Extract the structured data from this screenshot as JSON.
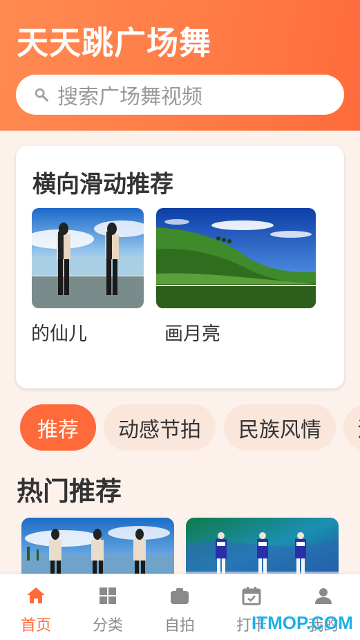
{
  "header": {
    "title": "天天跳广场舞",
    "search_placeholder": "搜索广场舞视频"
  },
  "recommend": {
    "title": "横向滑动推荐",
    "items": [
      {
        "label": "的仙儿"
      },
      {
        "label": "画月亮"
      }
    ]
  },
  "categories": {
    "chips": [
      "推荐",
      "动感节拍",
      "民族风情",
      "汉"
    ],
    "active": "推荐"
  },
  "hot": {
    "title": "热门推荐"
  },
  "tabbar": {
    "items": [
      {
        "label": "首页",
        "icon": "home-icon"
      },
      {
        "label": "分类",
        "icon": "grid-icon"
      },
      {
        "label": "自拍",
        "icon": "camera-icon"
      },
      {
        "label": "打卡",
        "icon": "calendar-check-icon"
      },
      {
        "label": "我的",
        "icon": "user-icon"
      }
    ],
    "active": "首页"
  },
  "watermark": "ITMOP.COM",
  "colors": {
    "accent": "#ff6a3a",
    "header_gradient_start": "#ff8a52",
    "background": "#fdf1ec",
    "watermark": "#1bb0e8"
  }
}
